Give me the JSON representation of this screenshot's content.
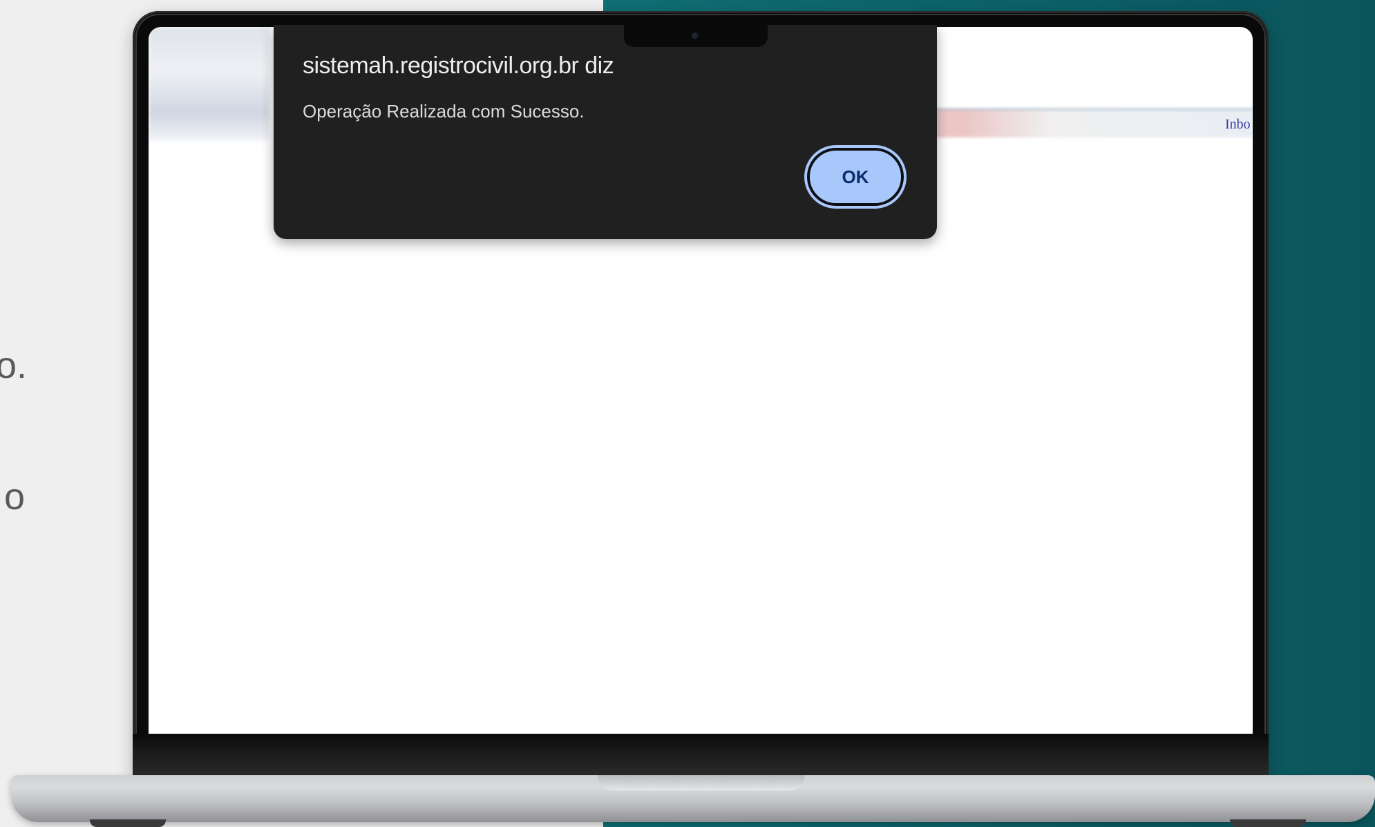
{
  "background": {
    "left_color": "#efefef",
    "right_color": "#0d6168",
    "side_text_lines": [
      "o.",
      "o"
    ]
  },
  "browser_page": {
    "partial_link": "Inbo"
  },
  "alert": {
    "title": "sistemah.registrocivil.org.br diz",
    "message": "Operação Realizada com Sucesso.",
    "ok_label": "OK",
    "dialog_color": "#202020",
    "button_color": "#a8c7fa"
  }
}
